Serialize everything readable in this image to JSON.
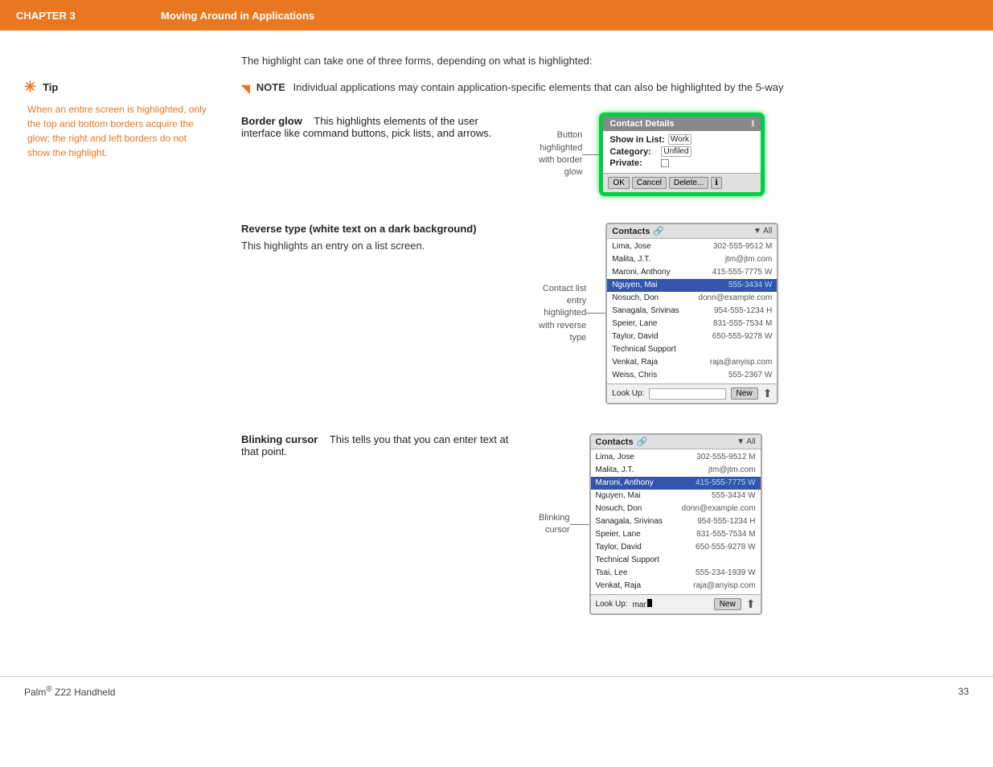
{
  "header": {
    "chapter": "CHAPTER 3",
    "title": "Moving Around in Applications"
  },
  "sidebar": {
    "tip_label": "Tip",
    "tip_body": "When an entire screen is highlighted, only the top and bottom borders acquire the glow; the right and left borders do not show the highlight."
  },
  "content": {
    "intro": "The highlight can take one of three forms, depending on what is highlighted:",
    "note_label": "NOTE",
    "note_text": "Individual applications may contain application-specific elements that can also be highlighted by the 5-way",
    "sections": [
      {
        "heading": "Border glow",
        "body": "This highlights elements of the user interface like command buttons, pick lists, and arrows.",
        "callout_label": "Button\nhighlighted\nwith border\nglow"
      },
      {
        "heading": "Reverse type (white text on a dark background)",
        "body": "This highlights an entry on a list screen.",
        "callout_label": "Contact list\nentry\nhighlighted\nwith reverse\ntype"
      },
      {
        "heading": "Blinking cursor",
        "body": "This tells you that you can enter text at that point.",
        "callout_label": "Blinking\ncursor"
      }
    ]
  },
  "contact_details_widget": {
    "title": "Contact Details",
    "show_in_list_label": "Show in List:",
    "show_in_list_value": "Work",
    "category_label": "Category:",
    "category_value": "Unfiled",
    "private_label": "Private:",
    "buttons": [
      "OK",
      "Cancel",
      "Delete..."
    ]
  },
  "contacts_widget": {
    "title": "Contacts",
    "filter": "▼ All",
    "entries": [
      {
        "name": "Lima, Jose",
        "detail": "302-555-9512 M"
      },
      {
        "name": "Malita, J.T.",
        "detail": "jtm@jtm.com"
      },
      {
        "name": "Maroni, Anthony",
        "detail": "415-555-7775 W"
      },
      {
        "name": "Nguyen, Mai",
        "detail": "555-3434 W",
        "highlighted": true
      },
      {
        "name": "Nosuch, Don",
        "detail": "donn@example.com"
      },
      {
        "name": "Sanagala, Srivinas",
        "detail": "954-555-1234 H"
      },
      {
        "name": "Speier, Lane",
        "detail": "831-555-7534 M"
      },
      {
        "name": "Taylor, David",
        "detail": "650-555-9278 W"
      },
      {
        "name": "Technical Support",
        "detail": ""
      },
      {
        "name": "Venkat, Raja",
        "detail": "raja@anyisp.com"
      },
      {
        "name": "Weiss, Chris",
        "detail": "555-2367 W"
      }
    ],
    "lookup_label": "Look Up:",
    "new_btn": "New"
  },
  "contacts_widget2": {
    "title": "Contacts",
    "filter": "▼ All",
    "entries": [
      {
        "name": "Lima, Jose",
        "detail": "302-555-9512 M"
      },
      {
        "name": "Malita, J.T.",
        "detail": "jtm@jtm.com"
      },
      {
        "name": "Maroni, Anthony",
        "detail": "415-555-7775 W",
        "highlighted": true
      },
      {
        "name": "Nguyen, Mai",
        "detail": "555-3434 W"
      },
      {
        "name": "Nosuch, Don",
        "detail": "donn@example.com"
      },
      {
        "name": "Sanagala, Srivinas",
        "detail": "954-555-1234 H"
      },
      {
        "name": "Speier, Lane",
        "detail": "831-555-7534 M"
      },
      {
        "name": "Taylor, David",
        "detail": "650-555-9278 W"
      },
      {
        "name": "Technical Support",
        "detail": ""
      },
      {
        "name": "Tsai, Lee",
        "detail": "555-234-1939 W"
      },
      {
        "name": "Venkat, Raja",
        "detail": "raja@anyisp.com"
      }
    ],
    "lookup_label": "Look Up:",
    "lookup_value": "mar",
    "new_btn": "New"
  },
  "footer": {
    "brand": "Palm® Z22 Handheld",
    "page": "33"
  }
}
